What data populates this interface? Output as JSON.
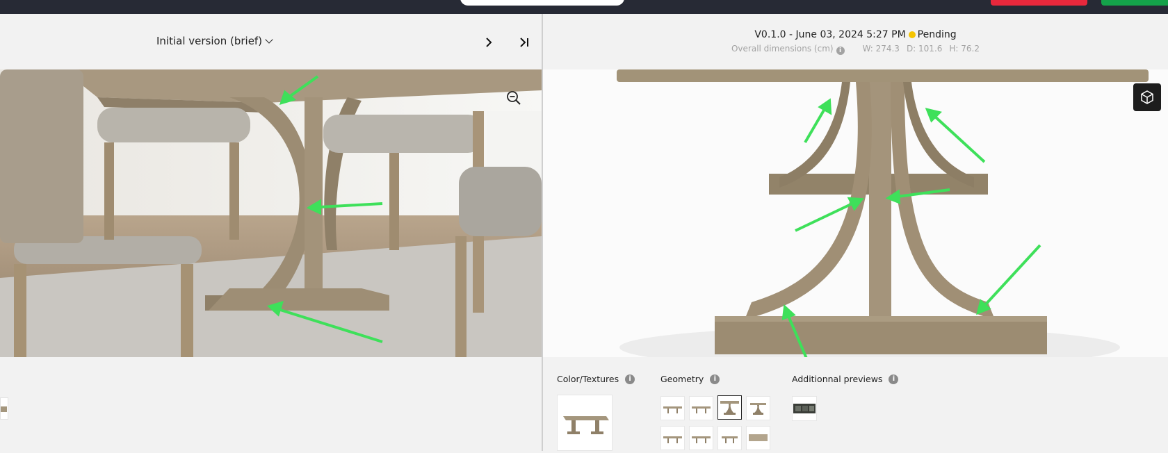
{
  "left_panel": {
    "version_label": "Initial version (brief)",
    "next_icon": "chevron-right-icon",
    "last_icon": "skip-to-last-icon",
    "zoom_icon": "zoom-out-icon"
  },
  "right_panel": {
    "version_title": "V0.1.0 - June 03, 2024 5:27 PM",
    "status": "Pending",
    "status_color": "#f5c400",
    "dimensions_label": "Overall dimensions (cm)",
    "width": "W: 274.3",
    "depth": "D: 101.6",
    "height": "H: 76.2",
    "cube_icon": "3d-cube-icon"
  },
  "sections": {
    "color_textures": "Color/Textures",
    "geometry": "Geometry",
    "additional_previews": "Additionnal previews"
  },
  "colors": {
    "topbar": "#272a35",
    "cancel": "#e8283c",
    "approve": "#14a24a",
    "annotation_arrow": "#3ee05a",
    "wood": "#a4967d"
  }
}
